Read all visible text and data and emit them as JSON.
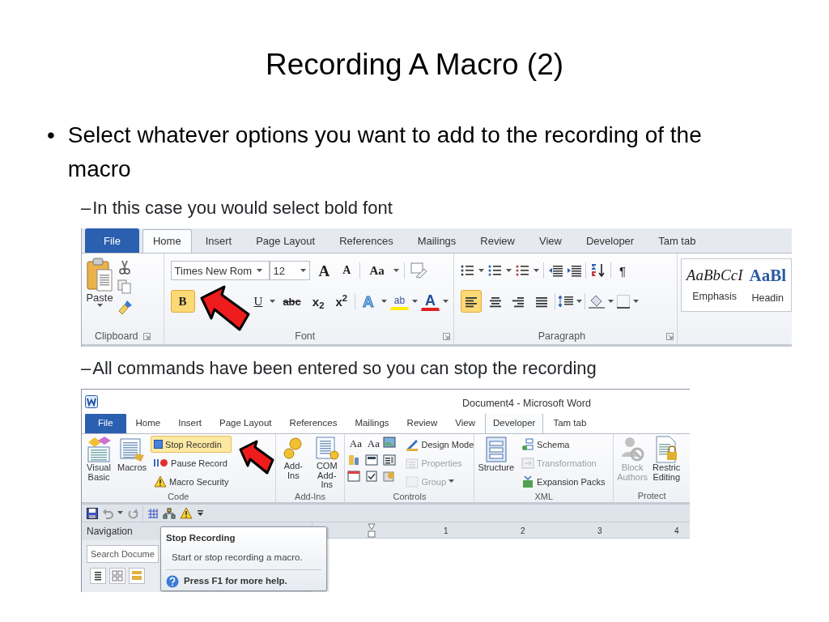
{
  "slide": {
    "title": "Recording A Macro (2)",
    "bullet_marker": "•",
    "bullet": "Select whatever options you want to add to the recording of the macro",
    "steps": [
      {
        "marker": "–",
        "text": "In this case you would select bold font"
      },
      {
        "marker": "–",
        "text": "All commands have been entered so you can stop the recording"
      }
    ]
  },
  "home_ribbon": {
    "tabs": [
      {
        "label": "File",
        "kind": "file",
        "selected": false
      },
      {
        "label": "Home",
        "kind": "tab",
        "selected": true
      },
      {
        "label": "Insert",
        "kind": "tab",
        "selected": false
      },
      {
        "label": "Page Layout",
        "kind": "tab",
        "selected": false
      },
      {
        "label": "References",
        "kind": "tab",
        "selected": false
      },
      {
        "label": "Mailings",
        "kind": "tab",
        "selected": false
      },
      {
        "label": "Review",
        "kind": "tab",
        "selected": false
      },
      {
        "label": "View",
        "kind": "tab",
        "selected": false
      },
      {
        "label": "Developer",
        "kind": "tab",
        "selected": false
      },
      {
        "label": "Tam tab",
        "kind": "tab",
        "selected": false
      }
    ],
    "clipboard": {
      "paste": "Paste",
      "label": "Clipboard"
    },
    "font": {
      "font_name": "Times New Rom",
      "font_size": "12",
      "grow": "A",
      "shrink": "A",
      "change_case": "Aa",
      "label": "Font",
      "format_buttons": [
        {
          "label": "B",
          "kind": "bold",
          "selected": true
        },
        {
          "label": "U",
          "kind": "underline",
          "selected": false
        },
        {
          "label": "abc",
          "kind": "strike",
          "selected": false
        },
        {
          "label": "x$_{2}$",
          "kind": "script",
          "selected": false
        },
        {
          "label": "x$^{2}$",
          "kind": "script",
          "selected": false
        },
        {
          "label": "A",
          "kind": "effects",
          "selected": false
        },
        {
          "label": "ab",
          "kind": "highlight",
          "selected": false
        },
        {
          "label": "A",
          "kind": "color",
          "selected": false
        }
      ]
    },
    "paragraph": {
      "pilcrow": "¶",
      "label": "Paragraph",
      "align_buttons": [
        {
          "selected": true
        },
        {
          "selected": false
        },
        {
          "selected": false
        },
        {
          "selected": false
        }
      ]
    },
    "styles": [
      {
        "sample": "AaBbCcI",
        "name": "Emphasis",
        "kind": "emphasis"
      },
      {
        "sample": "AaBl",
        "name": "Headin",
        "kind": "heading"
      }
    ]
  },
  "developer_window": {
    "title": "Document4 - Microsoft Word",
    "tabs": [
      {
        "label": "File",
        "kind": "file",
        "selected": false
      },
      {
        "label": "Home",
        "kind": "tab",
        "selected": false
      },
      {
        "label": "Insert",
        "kind": "tab",
        "selected": false
      },
      {
        "label": "Page Layout",
        "kind": "tab",
        "selected": false
      },
      {
        "label": "References",
        "kind": "tab",
        "selected": false
      },
      {
        "label": "Mailings",
        "kind": "tab",
        "selected": false
      },
      {
        "label": "Review",
        "kind": "tab",
        "selected": false
      },
      {
        "label": "View",
        "kind": "tab",
        "selected": false
      },
      {
        "label": "Developer",
        "kind": "tab",
        "selected": true
      },
      {
        "label": "Tam tab",
        "kind": "tab",
        "selected": false
      }
    ],
    "code": {
      "large": [
        {
          "lines": [
            "Visual",
            "Basic"
          ]
        },
        {
          "lines": [
            "Macros"
          ]
        }
      ],
      "commands": [
        {
          "label": "Stop Recordin",
          "highlighted": true
        },
        {
          "label": "Pause Record",
          "highlighted": false
        },
        {
          "label": "Macro Security",
          "highlighted": false
        }
      ],
      "label": "Code"
    },
    "add_ins": {
      "buttons": [
        {
          "lines": [
            "Add-Ins"
          ]
        },
        {
          "lines": [
            "COM",
            "Add-Ins"
          ]
        }
      ],
      "label": "Add-Ins"
    },
    "controls": {
      "glyphs": [
        "Aa",
        "Aa"
      ],
      "commands": [
        {
          "label": "Design Mode",
          "disabled": false
        },
        {
          "label": "Properties",
          "disabled": true
        },
        {
          "label": "Group",
          "disabled": true
        }
      ],
      "label": "Controls"
    },
    "xml": {
      "structure": "Structure",
      "commands": [
        {
          "label": "Schema",
          "disabled": false
        },
        {
          "label": "Transformation",
          "disabled": true
        },
        {
          "label": "Expansion Packs",
          "disabled": false
        }
      ],
      "label": "XML"
    },
    "protect": {
      "buttons": [
        {
          "lines": [
            "Block",
            "Authors"
          ],
          "disabled": true
        },
        {
          "lines": [
            "Restric",
            "Editing"
          ],
          "disabled": false
        }
      ],
      "label": "Protect"
    },
    "navigation": {
      "title": "Navigation",
      "placeholder": "Search Docume"
    },
    "ruler": {
      "numbers": [
        "1",
        "2",
        "3",
        "4"
      ]
    },
    "tooltip": {
      "title": "Stop Recording",
      "description": "Start or stop recording a macro.",
      "help": "Press F1 for more help."
    }
  }
}
